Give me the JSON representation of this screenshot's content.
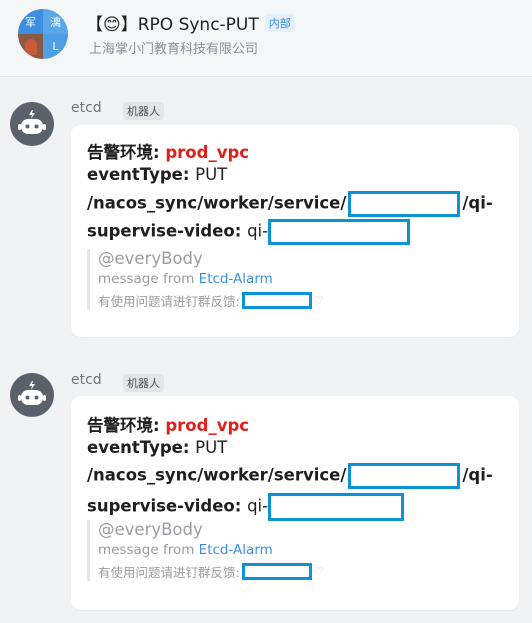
{
  "header": {
    "avatar_chars": [
      "军",
      "漓",
      "L"
    ],
    "title": "【😊】RPO Sync-PUT",
    "internal_tag": "内部",
    "subtitle": "上海掌小门教育科技有限公司"
  },
  "messages": [
    {
      "sender": "etcd",
      "sender_tag": "机器人",
      "env_label": "告警环境: ",
      "env_value": "prod_vpc",
      "event_label": "eventType: ",
      "event_value": "PUT",
      "path_prefix": "/nacos_sync/worker/service/",
      "path_suffix": "/qi-",
      "path_cont": "supervise-video: ",
      "qi_prefix": "qi-",
      "mention": "@everyBody",
      "from_label": "message from ",
      "from_link": "Etcd-Alarm",
      "feedback": "有使用问题请进钉群反馈:"
    },
    {
      "sender": "etcd",
      "sender_tag": "机器人",
      "env_label": "告警环境: ",
      "env_value": "prod_vpc",
      "event_label": "eventType: ",
      "event_value": "PUT",
      "path_prefix": "/nacos_sync/worker/service/",
      "path_suffix": "/qi-",
      "path_cont": "supervise-video: ",
      "qi_prefix": "qi-",
      "mention": "@everyBody",
      "from_label": "message from ",
      "from_link": "Etcd-Alarm",
      "feedback": "有使用问题请进钉群反馈:"
    }
  ],
  "colors": {
    "accent": "#e0201b",
    "link": "#3b8ee0",
    "redaction": "#0a94d6"
  }
}
